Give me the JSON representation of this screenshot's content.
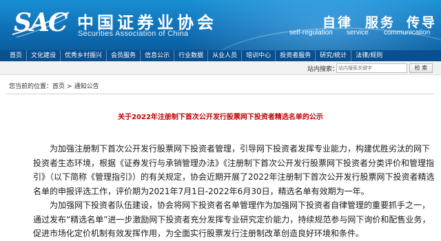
{
  "header": {
    "logo_mark": "SAC",
    "logo_cn": "中国证券业协会",
    "logo_en": "Securities Association of China",
    "slogans": [
      {
        "cn": "自律",
        "en": "self-regulation"
      },
      {
        "cn": "服务",
        "en": "service"
      },
      {
        "cn": "传导",
        "en": "communication"
      }
    ]
  },
  "nav": {
    "items": [
      "首页",
      "文化建设",
      "优秀乡村振兴",
      "会员服务",
      "信息公示",
      "行业数据",
      "从业人员",
      "培训中心",
      "投资者服务",
      "研究/统计",
      "法律/规则"
    ]
  },
  "search": {
    "label": "站内搜索：",
    "placeholder": "站内搜索关键字",
    "button": "检 索"
  },
  "breadcrumb": {
    "prefix": "您当前的位置：",
    "home": "首页",
    "sep": ">",
    "current": "通知公告"
  },
  "article": {
    "title": "关于2022年注册制下首次公开发行股票网下投资者精选名单的公示",
    "paragraphs": [
      "为加强注册制下首次公开发行股票网下投资者管理，引导网下投资者发挥专业能力，构建优胜劣汰的网下投资者生态环境，根据《证券发行与承销管理办法》《注册制下首次公开发行股票网下投资者分类评价和管理指引》（以下简称《管理指引》）的有关规定，协会近期开展了2022年注册制下首次公开发行股票网下投资者精选名单的申报评选工作，评价期为2021年7月1日-2022年6月30日，精选名单有效期为一年。",
      "为加强网下投资者队伍建设，协会将网下投资者名单管理作为加强网下投资者自律管理的重要抓手之一，通过发布“精选名单”进一步激励网下投资者充分发挥专业研究定价能力，持续规范参与网下询价和配售业务，促进市场化定价机制有效发挥作用，为全面实行股票发行注册制改革创造良好环境和条件。"
    ]
  },
  "colors": {
    "header": "#0f6eb4",
    "nav": "#0a4f8e",
    "title": "#c00000"
  }
}
